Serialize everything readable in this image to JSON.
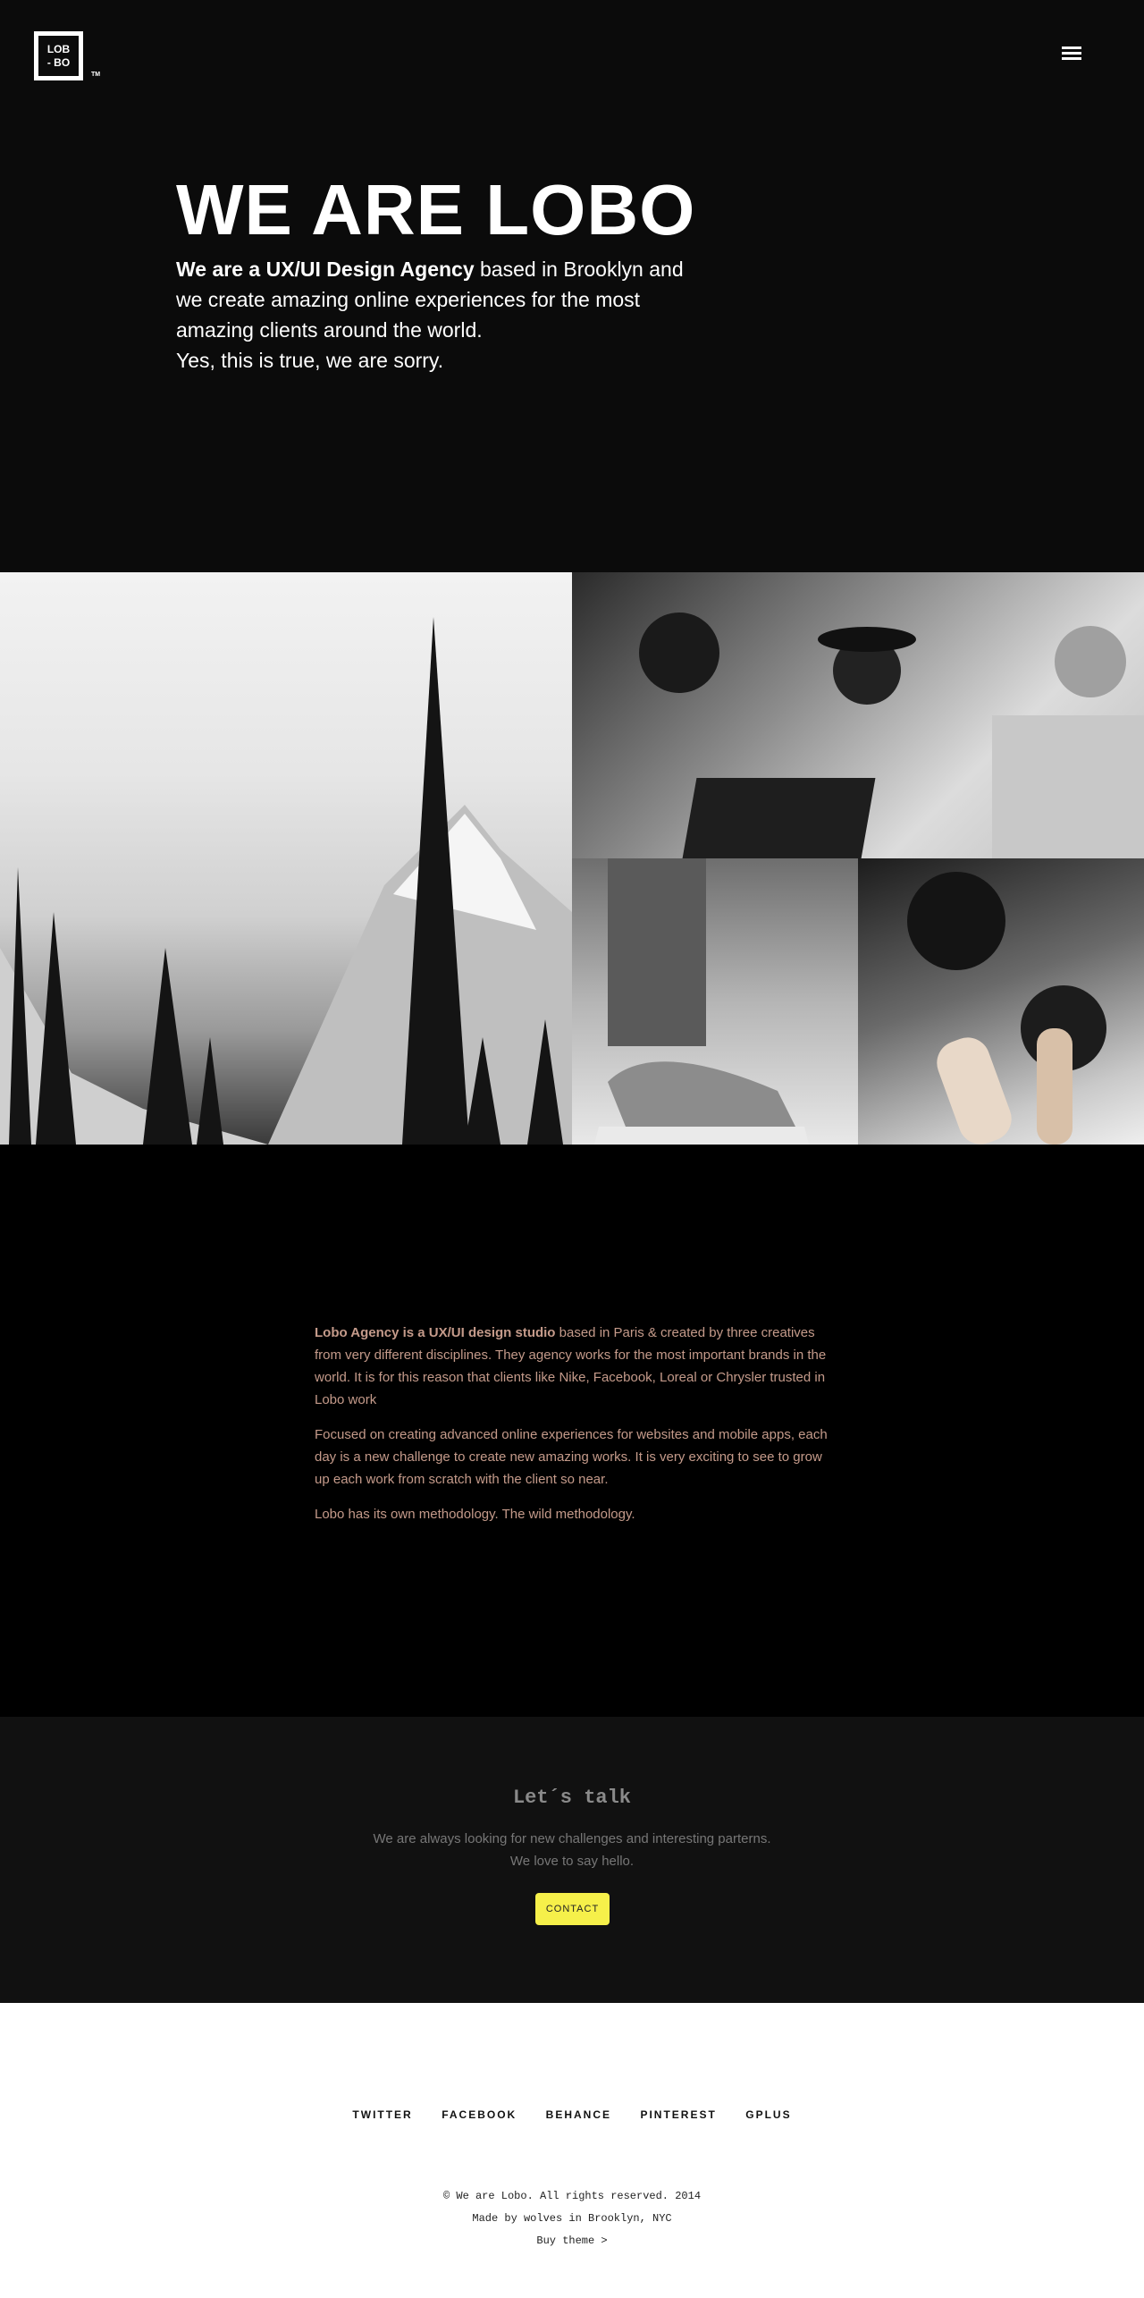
{
  "header": {
    "logo_line1": "LOB",
    "logo_line2": "- BO",
    "trademark": "TM"
  },
  "hero": {
    "title": "WE ARE LOBO",
    "text_bold": "We are a UX/UI Design Agency",
    "text_rest": " based in Brooklyn and we create amazing online experiences for the most amazing clients around the world.",
    "text_line2": "Yes, this is true, we are sorry."
  },
  "about": {
    "p1_bold": "Lobo Agency is a UX/UI design studio",
    "p1_rest": " based in Paris & created by three creatives from very different disciplines. They agency works for the most important brands in the world. It is for this reason that clients like Nike, Facebook, Loreal or Chrysler trusted in Lobo work",
    "p2": "Focused on creating advanced online experiences for websites and mobile apps, each day is a new challenge to create new amazing works. It is very exciting to see to grow up each work from scratch with the client so near.",
    "p3": "Lobo has its own methodology. The wild methodology."
  },
  "talk": {
    "title": "Let´s talk",
    "line1": "We are always looking for new challenges and interesting parterns.",
    "line2": "We love to say hello.",
    "button": "CONTACT"
  },
  "footer": {
    "social": [
      "TWITTER",
      "FACEBOOK",
      "BEHANCE",
      "PINTEREST",
      "GPLUS"
    ],
    "copyright": "© We are Lobo. All rights reserved. 2014",
    "made_by": "Made by wolves in Brooklyn, NYC",
    "buy_theme": "Buy theme >"
  }
}
